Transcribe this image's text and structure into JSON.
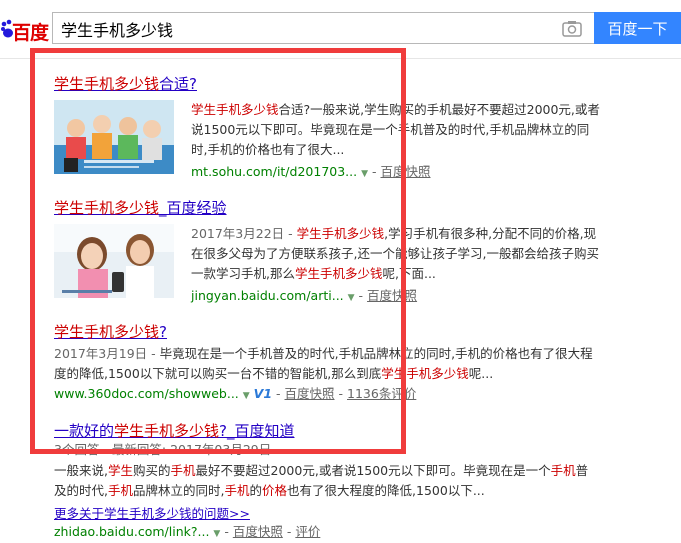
{
  "logo": {
    "text": "百度"
  },
  "search": {
    "query": "学生手机多少钱",
    "button_label": "百度一下"
  },
  "results": [
    {
      "title_em": "学生手机多少钱",
      "title_rest": "合适?",
      "abstract": [
        {
          "t": "学生手机多少钱",
          "em": true
        },
        {
          "t": "合适?一般来说,学生购买的手机最好不要超过2000元,或者说1500元以下即可。毕竟现在是一个手机普及的时代,手机品牌林立的同时,手机的价格也有了很大..."
        }
      ],
      "url": "mt.sohu.com/it/d201703...",
      "snapshot": "百度快照"
    },
    {
      "title_em": "学生手机多少钱",
      "title_rest": "_百度经验",
      "abstract": [
        {
          "t": "2017年3月22日 - ",
          "date": true
        },
        {
          "t": "学生手机多少钱",
          "em": true
        },
        {
          "t": ",学习手机有很多种,分配不同的价格,现在很多父母为了方便联系孩子,还一个能够让孩子学习,一般都会给孩子购买一款学习手机,那么"
        },
        {
          "t": "学生手机多少钱",
          "em": true
        },
        {
          "t": "呢,下面..."
        }
      ],
      "url": "jingyan.baidu.com/arti...",
      "snapshot": "百度快照"
    },
    {
      "title_em": "学生手机多少钱",
      "title_rest": "?",
      "abstract": [
        {
          "t": "2017年3月19日 - ",
          "date": true
        },
        {
          "t": "毕竟现在是一个手机普及的时代,手机品牌林立的同时,手机的价格也有了很大程度的降低,1500以下就可以购买一台不错的智能机,那么到底"
        },
        {
          "t": "学生手机多少钱",
          "em": true
        },
        {
          "t": "呢..."
        }
      ],
      "url": "www.360doc.com/showweb...",
      "badge": "V1",
      "snapshot": "百度快照",
      "reviews": "1136条评价"
    },
    {
      "title_pre": "一款好的",
      "title_em": "学生手机多少钱",
      "title_rest": "?_百度知道",
      "answer_meta": "3个回答 - 最新回答: 2017年03月29日",
      "abstract": [
        {
          "t": "一般来说,"
        },
        {
          "t": "学生",
          "em": true
        },
        {
          "t": "购买的"
        },
        {
          "t": "手机",
          "em": true
        },
        {
          "t": "最好不要超过2000元,或者说1500元以下即可。毕竟现在是一个"
        },
        {
          "t": "手机",
          "em": true
        },
        {
          "t": "普及的时代,"
        },
        {
          "t": "手机",
          "em": true
        },
        {
          "t": "品牌林立的同时,"
        },
        {
          "t": "手机",
          "em": true
        },
        {
          "t": "的"
        },
        {
          "t": "价格",
          "em": true
        },
        {
          "t": "也有了很大程度的降低,1500以下..."
        }
      ],
      "more_link": "更多关于学生手机多少钱的问题>>",
      "url": "zhidao.baidu.com/link?...",
      "snapshot": "百度快照",
      "reviews": "评价"
    }
  ],
  "colors": {
    "title_link": "#2300c5",
    "highlight": "#c00000",
    "url": "#008000",
    "button": "#3385ff",
    "annotation_box": "#f03c3c"
  }
}
